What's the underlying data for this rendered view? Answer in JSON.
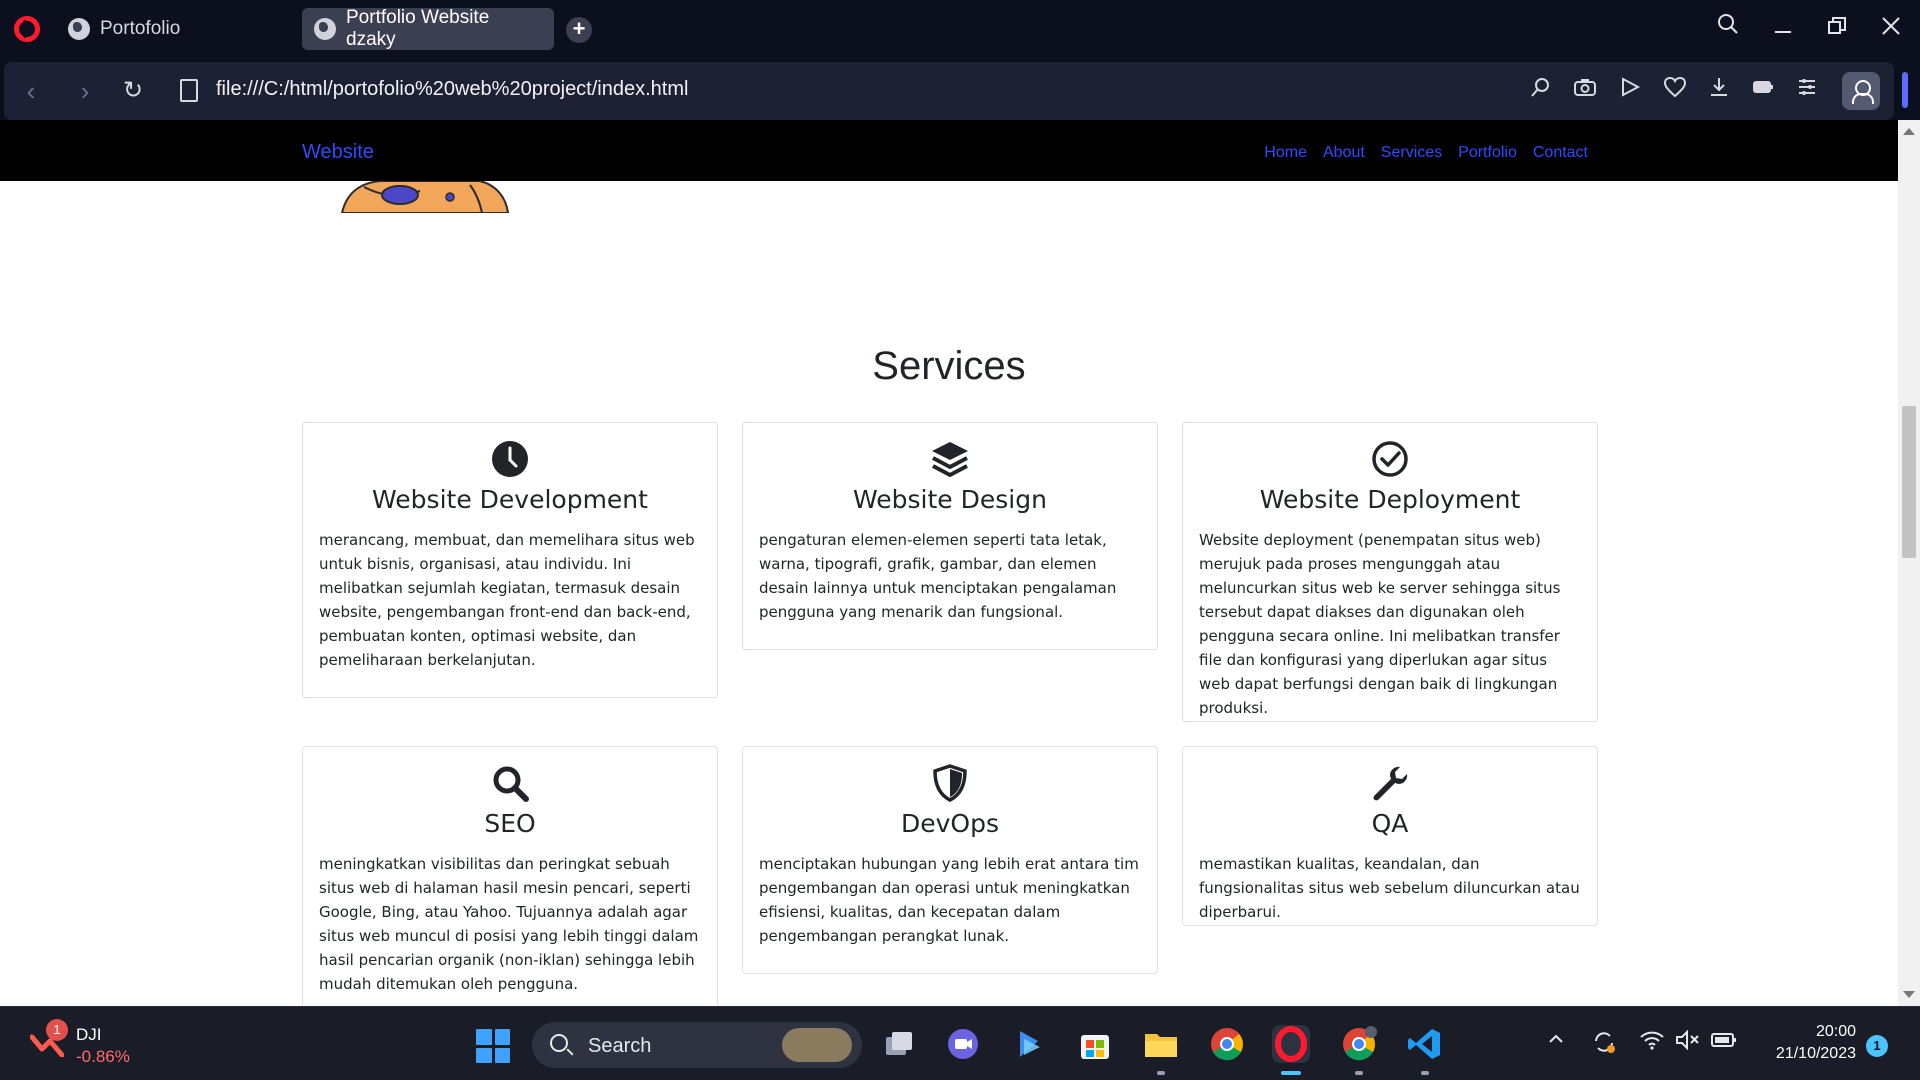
{
  "browser": {
    "tabs": [
      {
        "title": "Portofolio"
      },
      {
        "title": "Portfolio Website dzaky"
      }
    ],
    "address": "file:///C:/html/portofolio%20web%20project/index.html"
  },
  "site": {
    "brand": "Website",
    "nav": [
      "Home",
      "About",
      "Services",
      "Portfolio",
      "Contact"
    ],
    "section_title": "Services",
    "cards": [
      {
        "icon": "clock-icon",
        "title": "Website Development",
        "text": "merancang, membuat, dan memelihara situs web untuk bisnis, organisasi, atau individu. Ini melibatkan sejumlah kegiatan, termasuk desain website, pengembangan front-end dan back-end, pembuatan konten, optimasi website, dan pemeliharaan berkelanjutan."
      },
      {
        "icon": "layers-icon",
        "title": "Website Design",
        "text": "pengaturan elemen-elemen seperti tata letak, warna, tipografi, grafik, gambar, dan elemen desain lainnya untuk menciptakan pengalaman pengguna yang menarik dan fungsional."
      },
      {
        "icon": "check-circle-icon",
        "title": "Website Deployment",
        "text": "Website deployment (penempatan situs web) merujuk pada proses mengunggah atau meluncurkan situs web ke server sehingga situs tersebut dapat diakses dan digunakan oleh pengguna secara online. Ini melibatkan transfer file dan konfigurasi yang diperlukan agar situs web dapat berfungsi dengan baik di lingkungan produksi."
      },
      {
        "icon": "search-icon",
        "title": "SEO",
        "text": "meningkatkan visibilitas dan peringkat sebuah situs web di halaman hasil mesin pencari, seperti Google, Bing, atau Yahoo. Tujuannya adalah agar situs web muncul di posisi yang lebih tinggi dalam hasil pencarian organik (non-iklan) sehingga lebih mudah ditemukan oleh pengguna."
      },
      {
        "icon": "shield-icon",
        "title": "DevOps",
        "text": "menciptakan hubungan yang lebih erat antara tim pengembangan dan operasi untuk meningkatkan efisiensi, kualitas, dan kecepatan dalam pengembangan perangkat lunak."
      },
      {
        "icon": "wrench-icon",
        "title": "QA",
        "text": "memastikan kualitas, keandalan, dan fungsionalitas situs web sebelum diluncurkan atau diperbarui."
      }
    ]
  },
  "taskbar": {
    "widget": {
      "badge": "1",
      "name": "DJI",
      "change": "-0.86%"
    },
    "search_label": "Search",
    "time": "20:00",
    "date": "21/10/2023",
    "notifications": "1"
  }
}
